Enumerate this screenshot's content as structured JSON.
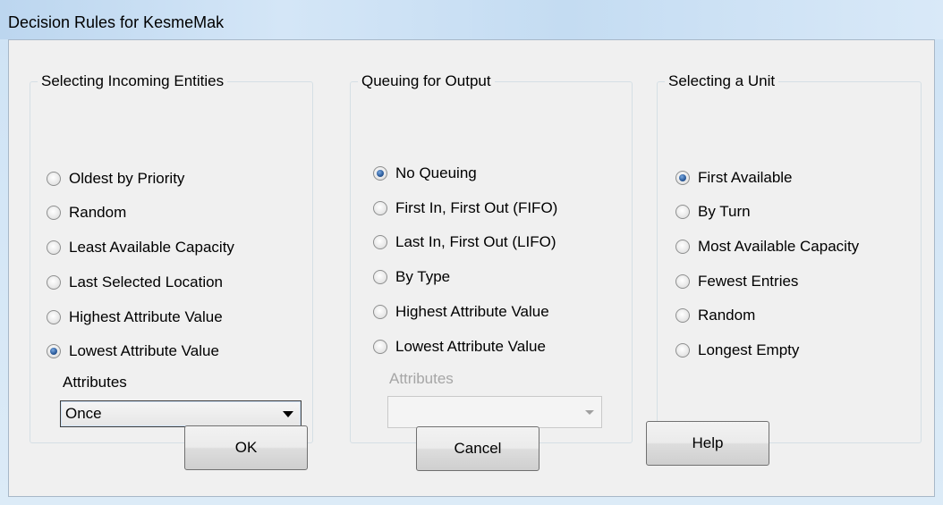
{
  "window": {
    "title": "Decision Rules for KesmeMak"
  },
  "incoming": {
    "label": "Selecting Incoming Entities",
    "options": [
      {
        "label": "Oldest by Priority",
        "checked": false
      },
      {
        "label": "Random",
        "checked": false
      },
      {
        "label": "Least Available Capacity",
        "checked": false
      },
      {
        "label": "Last Selected Location",
        "checked": false
      },
      {
        "label": "Highest Attribute Value",
        "checked": false
      },
      {
        "label": "Lowest Attribute Value",
        "checked": true
      }
    ],
    "attributes_label": "Attributes",
    "attributes_value": "Once"
  },
  "queuing": {
    "label": "Queuing for Output",
    "options": [
      {
        "label": "No Queuing",
        "checked": true
      },
      {
        "label": "First In, First Out (FIFO)",
        "checked": false
      },
      {
        "label": "Last In, First Out (LIFO)",
        "checked": false
      },
      {
        "label": "By Type",
        "checked": false
      },
      {
        "label": "Highest Attribute Value",
        "checked": false
      },
      {
        "label": "Lowest Attribute Value",
        "checked": false
      }
    ],
    "attributes_label": "Attributes",
    "attributes_value": ""
  },
  "unit": {
    "label": "Selecting a Unit",
    "options": [
      {
        "label": "First Available",
        "checked": true
      },
      {
        "label": "By Turn",
        "checked": false
      },
      {
        "label": "Most Available Capacity",
        "checked": false
      },
      {
        "label": "Fewest Entries",
        "checked": false
      },
      {
        "label": "Random",
        "checked": false
      },
      {
        "label": "Longest Empty",
        "checked": false
      }
    ]
  },
  "buttons": {
    "ok": "OK",
    "cancel": "Cancel",
    "help": "Help"
  }
}
